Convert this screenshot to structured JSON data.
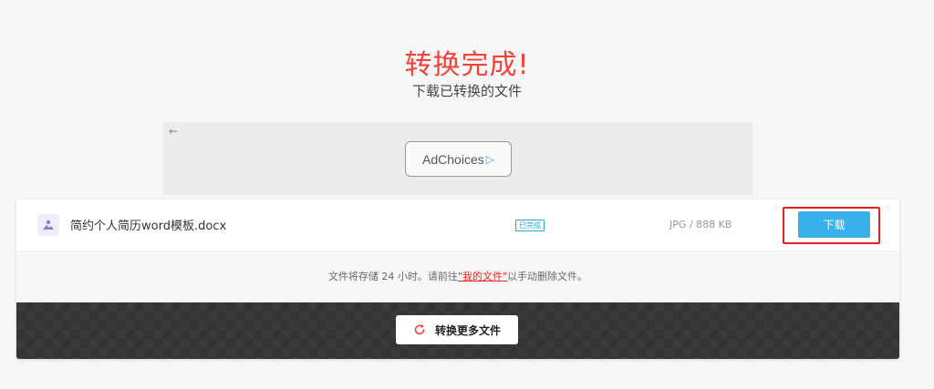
{
  "header": {
    "title": "转换完成!",
    "subtitle": "下载已转换的文件"
  },
  "ad": {
    "back_icon": "arrow-left-icon",
    "adchoices_label": "AdChoices",
    "adchoices_icon": "adchoices-triangle-icon"
  },
  "file": {
    "icon": "image-file-icon",
    "name": "简约个人简历word模板.docx",
    "status": "已完成",
    "info": "JPG / 888 KB",
    "download_label": "下载"
  },
  "notice": {
    "before": "文件将存储 24 小时。请前往",
    "link": "\"我的文件\"",
    "after": "以手动删除文件。"
  },
  "footer": {
    "convert_more_label": "转换更多文件",
    "convert_more_icon": "refresh-icon"
  },
  "colors": {
    "title_red": "#f0433a",
    "accent_blue": "#38b1ea",
    "highlight_red": "#e52222"
  }
}
